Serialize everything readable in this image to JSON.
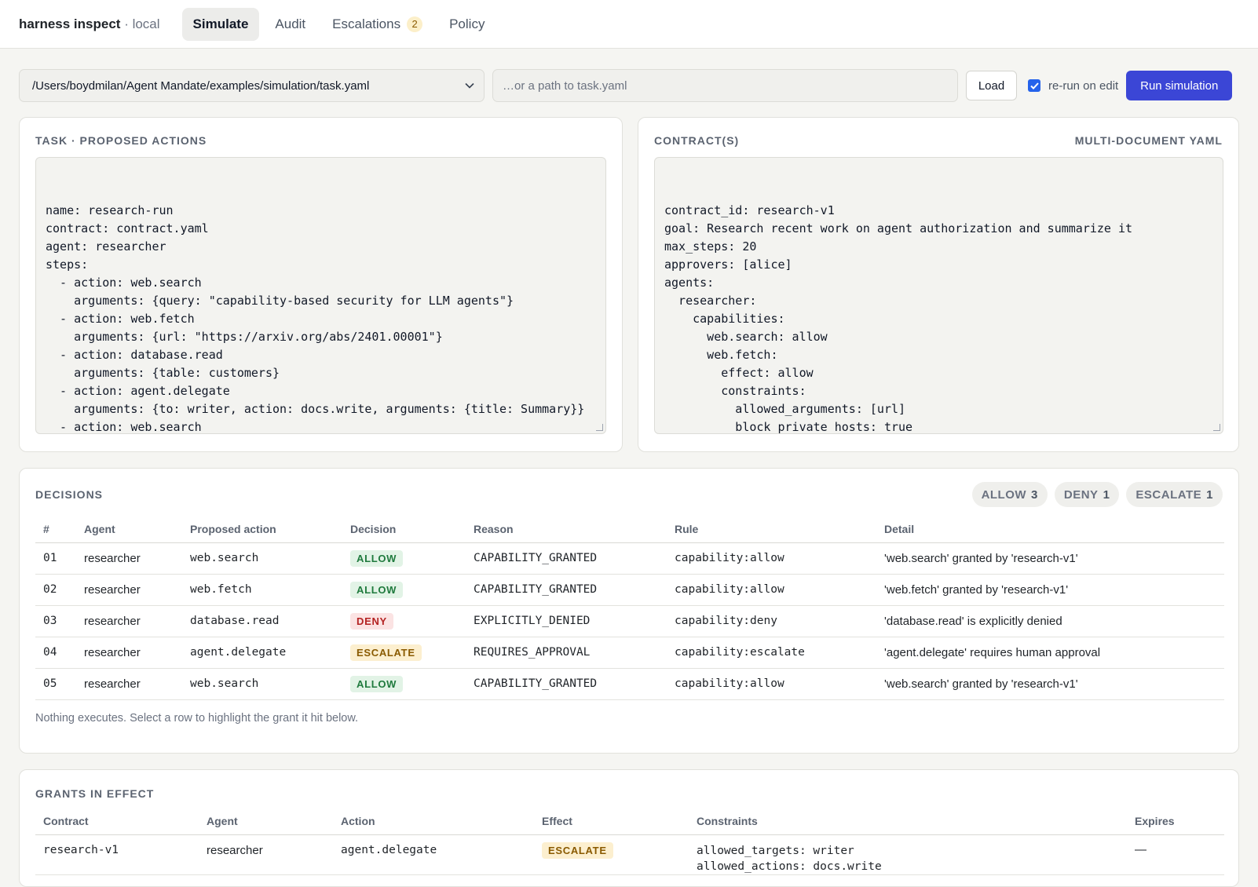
{
  "app": {
    "name": "harness inspect",
    "env": "· local"
  },
  "tabs": [
    {
      "label": "Simulate",
      "active": true
    },
    {
      "label": "Audit"
    },
    {
      "label": "Escalations",
      "count": "2"
    },
    {
      "label": "Policy"
    }
  ],
  "toolbar": {
    "selected_file": "/Users/boydmilan/Agent Mandate/examples/simulation/task.yaml",
    "path_placeholder": "…or a path to task.yaml",
    "load_label": "Load",
    "rerun_label": "re-run on edit",
    "rerun_checked": true,
    "run_label": "Run simulation"
  },
  "task_panel": {
    "title": "TASK · PROPOSED ACTIONS",
    "content": "name: research-run\ncontract: contract.yaml\nagent: researcher\nsteps:\n  - action: web.search\n    arguments: {query: \"capability-based security for LLM agents\"}\n  - action: web.fetch\n    arguments: {url: \"https://arxiv.org/abs/2401.00001\"}\n  - action: database.read\n    arguments: {table: customers}\n  - action: agent.delegate\n    arguments: {to: writer, action: docs.write, arguments: {title: Summary}}\n  - action: web.search\n    arguments: {query: \"confused deputy problem\"}"
  },
  "contract_panel": {
    "title": "CONTRACT(S)",
    "subtitle": "MULTI-DOCUMENT YAML",
    "content": "contract_id: research-v1\ngoal: Research recent work on agent authorization and summarize it\nmax_steps: 20\napprovers: [alice]\nagents:\n  researcher:\n    capabilities:\n      web.search: allow\n      web.fetch:\n        effect: allow\n        constraints:\n          allowed_arguments: [url]\n          block_private_hosts: true\n          blocked_domains: [internal.example]\n      database.read: deny"
  },
  "decisions": {
    "title": "DECISIONS",
    "summary": [
      {
        "label": "ALLOW",
        "count": "3"
      },
      {
        "label": "DENY",
        "count": "1"
      },
      {
        "label": "ESCALATE",
        "count": "1"
      }
    ],
    "columns": [
      "#",
      "Agent",
      "Proposed action",
      "Decision",
      "Reason",
      "Rule",
      "Detail"
    ],
    "rows": [
      {
        "num": "01",
        "agent": "researcher",
        "action": "web.search",
        "decision": "ALLOW",
        "reason": "CAPABILITY_GRANTED",
        "rule": "capability:allow",
        "detail": "'web.search' granted by 'research-v1'"
      },
      {
        "num": "02",
        "agent": "researcher",
        "action": "web.fetch",
        "decision": "ALLOW",
        "reason": "CAPABILITY_GRANTED",
        "rule": "capability:allow",
        "detail": "'web.fetch' granted by 'research-v1'"
      },
      {
        "num": "03",
        "agent": "researcher",
        "action": "database.read",
        "decision": "DENY",
        "reason": "EXPLICITLY_DENIED",
        "rule": "capability:deny",
        "detail": "'database.read' is explicitly denied"
      },
      {
        "num": "04",
        "agent": "researcher",
        "action": "agent.delegate",
        "decision": "ESCALATE",
        "reason": "REQUIRES_APPROVAL",
        "rule": "capability:escalate",
        "detail": "'agent.delegate' requires human approval"
      },
      {
        "num": "05",
        "agent": "researcher",
        "action": "web.search",
        "decision": "ALLOW",
        "reason": "CAPABILITY_GRANTED",
        "rule": "capability:allow",
        "detail": "'web.search' granted by 'research-v1'"
      }
    ],
    "footnote": "Nothing executes. Select a row to highlight the grant it hit below."
  },
  "grants": {
    "title": "GRANTS IN EFFECT",
    "columns": [
      "Contract",
      "Agent",
      "Action",
      "Effect",
      "Constraints",
      "Expires"
    ],
    "rows": [
      {
        "contract": "research-v1",
        "agent": "researcher",
        "action": "agent.delegate",
        "effect": "ESCALATE",
        "constraints": "allowed_targets: writer\nallowed_actions: docs.write",
        "expires": "—"
      }
    ]
  },
  "colors": {
    "accent": "#3b46d6",
    "allow": "#1f7a3d",
    "deny": "#b42323",
    "escalate": "#8a5a00"
  }
}
